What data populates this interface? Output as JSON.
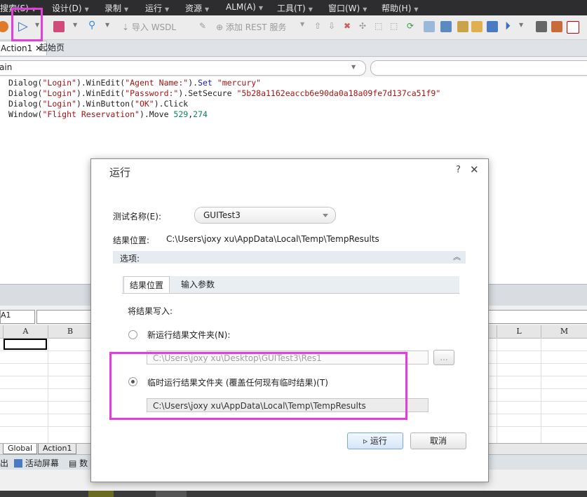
{
  "menu": [
    {
      "label": "搜索(S)"
    },
    {
      "label": "设计(D)"
    },
    {
      "label": "录制"
    },
    {
      "label": "运行"
    },
    {
      "label": "资源"
    },
    {
      "label": "ALM(A)"
    },
    {
      "label": "工具(T)"
    },
    {
      "label": "窗口(W)"
    },
    {
      "label": "帮助(H)"
    }
  ],
  "toolbar": {
    "import_wsdl": "导入 WSDL",
    "add_rest": "添加 REST 服务"
  },
  "doc_tabs": {
    "action1": "Action1",
    "start_page": "起始页"
  },
  "address": {
    "left_value": "ain"
  },
  "code_lines": [
    "Dialog(\"Login\").WinEdit(\"Agent Name:\").Set \"mercury\"",
    "Dialog(\"Login\").WinEdit(\"Password:\").SetSecure \"5b28a1162eaccb6e90da0a18a09fe7d137ca51f9\"",
    "Dialog(\"Login\").WinButton(\"OK\").Click",
    "Window(\"Flight Reservation\").Move 529,274"
  ],
  "datatable": {
    "cell_ref": "A1",
    "columns": [
      "A",
      "B",
      "L",
      "M"
    ],
    "sheet_tabs": [
      "Global",
      "Action1"
    ]
  },
  "bottom_tabs": {
    "output": "出",
    "active_screen": "活动屏幕",
    "data": "数"
  },
  "dialog": {
    "title": "运行",
    "help": "?",
    "close": "✕",
    "test_name_label": "测试名称(E):",
    "test_name_value": "GUITest3",
    "result_location_label": "结果位置:",
    "result_location_value": "C:\\Users\\joxy xu\\AppData\\Local\\Temp\\TempResults",
    "options_label": "选项:",
    "tabs": [
      "结果位置",
      "输入参数"
    ],
    "write_results_label": "将结果写入:",
    "new_folder_label": "新运行结果文件夹(N):",
    "new_folder_path": "C:\\Users\\joxy xu\\Desktop\\GUITest3\\Res1",
    "browse_label": "...",
    "temp_folder_label": "临时运行结果文件夹 (覆盖任何现有临时结果)(T)",
    "temp_folder_path": "C:\\Users\\joxy xu\\AppData\\Local\\Temp\\TempResults",
    "run_button": "▹ 运行",
    "cancel_button": "取消"
  },
  "colors": {
    "highlight": "#e040d8",
    "menubar": "#2d2d30"
  }
}
